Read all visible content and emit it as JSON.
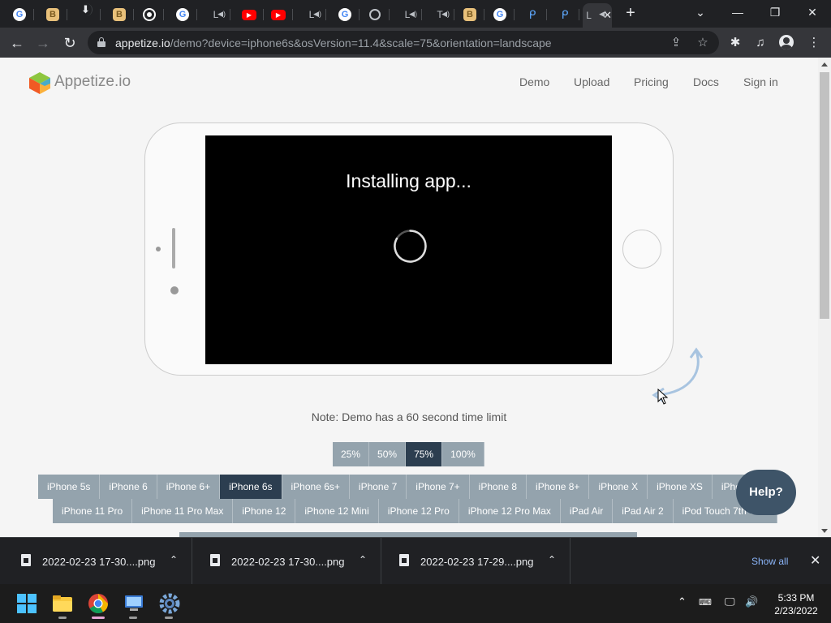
{
  "browser": {
    "tabs": [
      {
        "icon": "google-icon",
        "glyph": "G"
      },
      {
        "icon": "bookmark-app-icon",
        "glyph": "B"
      },
      {
        "icon": "download-icon",
        "glyph": "⬇"
      },
      {
        "icon": "bookmark-app-icon",
        "glyph": "B"
      },
      {
        "icon": "chrome-icon",
        "glyph": ""
      },
      {
        "icon": "google-icon",
        "glyph": "G"
      },
      {
        "icon": "page-l-icon",
        "glyph": "L"
      },
      {
        "icon": "youtube-icon",
        "glyph": "▶"
      },
      {
        "icon": "youtube-icon",
        "glyph": "▶"
      },
      {
        "icon": "page-l-icon",
        "glyph": "L"
      },
      {
        "icon": "google-icon",
        "glyph": "G"
      },
      {
        "icon": "globe-icon",
        "glyph": ""
      },
      {
        "icon": "page-l-icon",
        "glyph": "L"
      },
      {
        "icon": "page-t-icon",
        "glyph": "T"
      },
      {
        "icon": "bookmark-app-icon",
        "glyph": "B"
      },
      {
        "icon": "google-icon",
        "glyph": "G"
      },
      {
        "icon": "p-app-icon",
        "glyph": "ᑭ"
      },
      {
        "icon": "p-app-icon",
        "glyph": "ᑭ"
      },
      {
        "icon": "page-l-icon",
        "glyph": "L"
      }
    ],
    "address": {
      "host": "appetize.io",
      "path": "/demo?device=iphone6s&osVersion=11.4&scale=75&orientation=landscape"
    }
  },
  "site": {
    "brand": "Appetize.io",
    "nav": [
      "Demo",
      "Upload",
      "Pricing",
      "Docs",
      "Sign in"
    ],
    "installing": "Installing app...",
    "note": "Note: Demo has a 60 second time limit",
    "scales": [
      "25%",
      "50%",
      "75%",
      "100%"
    ],
    "selected_scale": "75%",
    "devices_row1": [
      "iPhone 5s",
      "iPhone 6",
      "iPhone 6+",
      "iPhone 6s",
      "iPhone 6s+",
      "iPhone 7",
      "iPhone 7+",
      "iPhone 8",
      "iPhone 8+",
      "iPhone X",
      "iPhone XS",
      "iPhone"
    ],
    "devices_row2": [
      "iPhone 11 Pro",
      "iPhone 11 Pro Max",
      "iPhone 12",
      "iPhone 12 Mini",
      "iPhone 12 Pro",
      "iPhone 12 Pro Max",
      "iPad Air",
      "iPad Air 2",
      "iPod Touch 7th Gen"
    ],
    "selected_device": "iPhone 6s",
    "help": "Help?"
  },
  "downloads": {
    "items": [
      "2022-02-23 17-30....png",
      "2022-02-23 17-30....png",
      "2022-02-23 17-29....png"
    ],
    "show_all": "Show all"
  },
  "taskbar": {
    "time": "5:33 PM",
    "date": "2/23/2022"
  },
  "colors": {
    "button": "#94a3ad",
    "selected": "#2c3e50",
    "help": "#3e5468"
  }
}
